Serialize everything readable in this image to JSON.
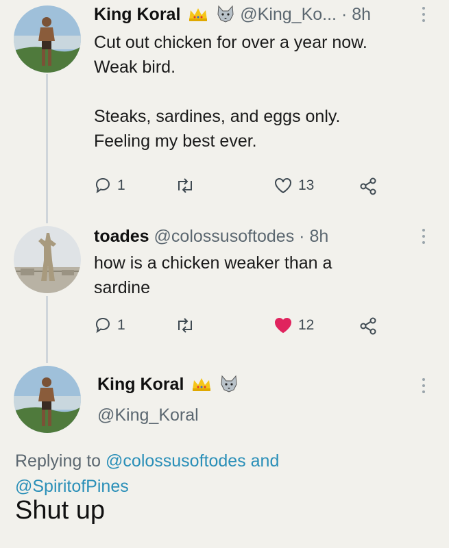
{
  "tweets": [
    {
      "name": "King Koral",
      "handle": "@King_Ko...",
      "separator": "·",
      "time": "8h",
      "text_line1": "Cut out chicken for over a year now.",
      "text_line2": "Weak bird.",
      "text_line3": "Steaks, sardines, and eggs only.",
      "text_line4": "Feeling my best ever.",
      "replies": "1",
      "likes": "13"
    },
    {
      "name": "toades",
      "handle": "@colossusoftodes",
      "separator": "·",
      "time": "8h",
      "text_line1": "how is a chicken weaker than a",
      "text_line2": "sardine",
      "replies": "1",
      "likes": "12",
      "liked": true
    },
    {
      "name": "King Koral",
      "handle": "@King_Koral",
      "replying_prefix": "Replying to",
      "replying_user1": "@colossusoftodes",
      "replying_and": "and",
      "replying_user2": "@SpiritofPines",
      "text": "Shut up"
    }
  ],
  "colors": {
    "background": "#f2f1ec",
    "link": "#2a8fb8",
    "like_active": "#e0245e",
    "muted": "#5b6770"
  },
  "icons": [
    "crown-emoji-icon",
    "wolf-emoji-icon",
    "more-icon",
    "reply-icon",
    "retweet-icon",
    "like-icon",
    "share-icon"
  ]
}
